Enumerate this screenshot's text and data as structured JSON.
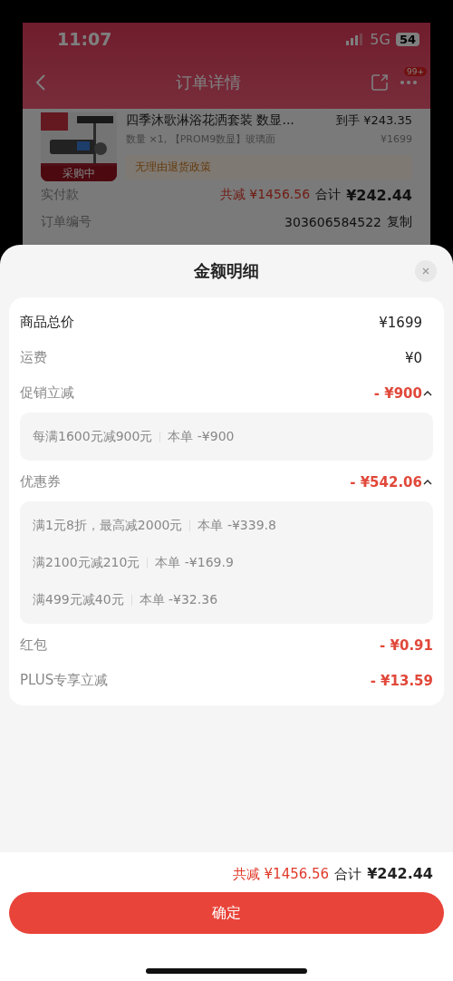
{
  "status_bar": {
    "time": "11:07",
    "network": "5G",
    "battery": "54"
  },
  "header": {
    "title": "订单详情",
    "badge": "99+"
  },
  "product": {
    "name": "四季沐歌淋浴花洒套装 数显...",
    "price_label": "到手",
    "price": "¥243.35",
    "spec": "数量 ×1, 【PROM9数显】玻璃面",
    "original_price": "¥1699",
    "image_badge": "采购中",
    "policy": "无理由退货政策"
  },
  "order_rows": [
    {
      "label": "实付款",
      "discount": "共减 ¥1456.56",
      "total_label": "合计",
      "total": "¥242.44"
    },
    {
      "label": "订单编号",
      "number": "303606584522",
      "action": "复制"
    }
  ],
  "sheet": {
    "title": "金额明细",
    "rows": [
      {
        "kind": "total",
        "label": "商品总价",
        "value": "¥1699"
      },
      {
        "kind": "fee",
        "label": "运费",
        "value": "¥0"
      },
      {
        "kind": "discount",
        "label": "促销立减",
        "value": "- ¥900",
        "expanded": true,
        "details": [
          {
            "rule": "每满1600元减900元",
            "amount": "本单 -¥900"
          }
        ]
      },
      {
        "kind": "discount",
        "label": "优惠券",
        "value": "- ¥542.06",
        "expanded": true,
        "details": [
          {
            "rule": "满1元8折，最高减2000元",
            "amount": "本单 -¥339.8"
          },
          {
            "rule": "满2100元减210元",
            "amount": "本单 -¥169.9"
          },
          {
            "rule": "满499元减40元",
            "amount": "本单 -¥32.36"
          }
        ]
      },
      {
        "kind": "discount",
        "label": "红包",
        "value": "- ¥0.91"
      },
      {
        "kind": "discount",
        "label": "PLUS专享立减",
        "value": "- ¥13.59"
      }
    ]
  },
  "footer": {
    "discount": "共减 ¥1456.56",
    "total_label": "合计",
    "total": "¥242.44",
    "button": "确定"
  }
}
